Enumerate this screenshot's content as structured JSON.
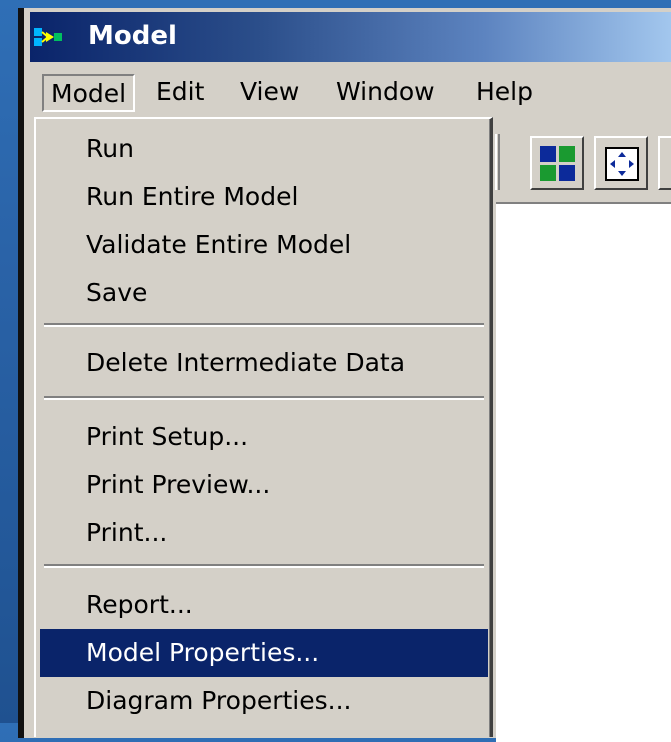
{
  "window": {
    "title": "Model"
  },
  "menubar": {
    "items": [
      {
        "label": "Model"
      },
      {
        "label": "Edit"
      },
      {
        "label": "View"
      },
      {
        "label": "Window"
      },
      {
        "label": "Help"
      }
    ]
  },
  "dropdown": {
    "groups": [
      [
        "Run",
        "Run Entire Model",
        "Validate Entire Model",
        "Save"
      ],
      [
        "Delete Intermediate Data"
      ],
      [
        "Print Setup...",
        "Print Preview...",
        "Print..."
      ],
      [
        "Report...",
        "Model Properties...",
        "Diagram Properties..."
      ]
    ],
    "highlighted": "Model Properties..."
  },
  "toolbar": {
    "buttons": [
      "tile-windows-icon",
      "fit-to-window-icon"
    ]
  },
  "colors": {
    "titlebar_start": "#0a246a",
    "highlight": "#0a246a",
    "face": "#d4d0c8",
    "desktop": "#2a63a8"
  }
}
